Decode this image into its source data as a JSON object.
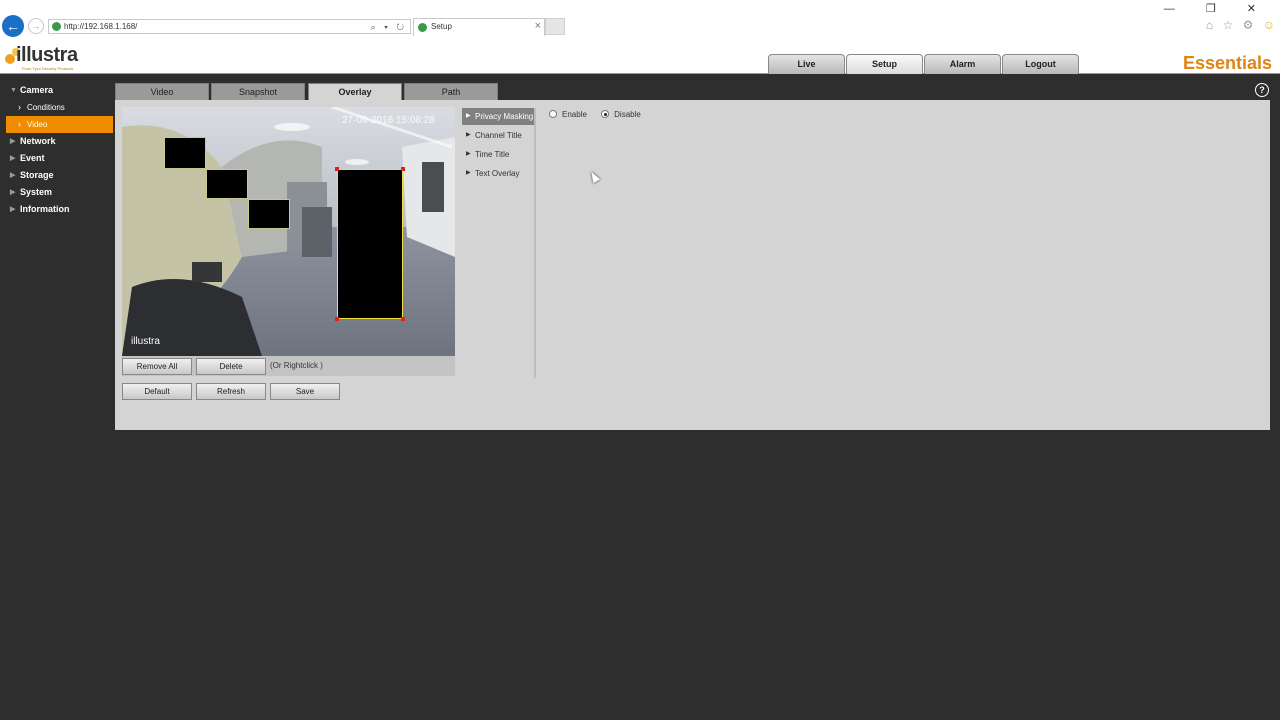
{
  "browser": {
    "url": "http://192.168.1.168/",
    "tab_title": "Setup",
    "tab_close": "×",
    "address_icons": "⌕ ▾ ↻",
    "window_controls": "— ❐ ✕",
    "toolbar_icons": [
      "⌂",
      "☆",
      "⚙",
      "☺"
    ]
  },
  "header": {
    "logo_text": "illustra",
    "logo_tagline": "From Tyco Security Products",
    "brand": "Essentials",
    "tabs": [
      {
        "label": "Live",
        "active": false
      },
      {
        "label": "Setup",
        "active": true
      },
      {
        "label": "Alarm",
        "active": false
      },
      {
        "label": "Logout",
        "active": false
      }
    ]
  },
  "sidebar": {
    "camera": "Camera",
    "conditions": "Conditions",
    "video": "Video",
    "network": "Network",
    "event": "Event",
    "storage": "Storage",
    "system": "System",
    "information": "Information",
    "active_color": "#f08c00"
  },
  "subtabs": [
    {
      "label": "Video",
      "active": false
    },
    {
      "label": "Snapshot",
      "active": false
    },
    {
      "label": "Overlay",
      "active": true
    },
    {
      "label": "Path",
      "active": false
    }
  ],
  "help_label": "?",
  "preview": {
    "timestamp": "27-09-2016 15:08:28",
    "watermark": "illustra"
  },
  "buttons": {
    "remove_all": "Remove All",
    "delete": "Delete",
    "rightclick_hint": "(Or Rightclick )",
    "default": "Default",
    "refresh": "Refresh",
    "save": "Save"
  },
  "overlay_menu": [
    {
      "label": "Privacy Masking",
      "active": true
    },
    {
      "label": "Channel Title",
      "active": false
    },
    {
      "label": "Time Title",
      "active": false
    },
    {
      "label": "Text Overlay",
      "active": false
    }
  ],
  "privacy_mask": {
    "enable_label": "Enable",
    "disable_label": "Disable",
    "selected": "Disable"
  }
}
